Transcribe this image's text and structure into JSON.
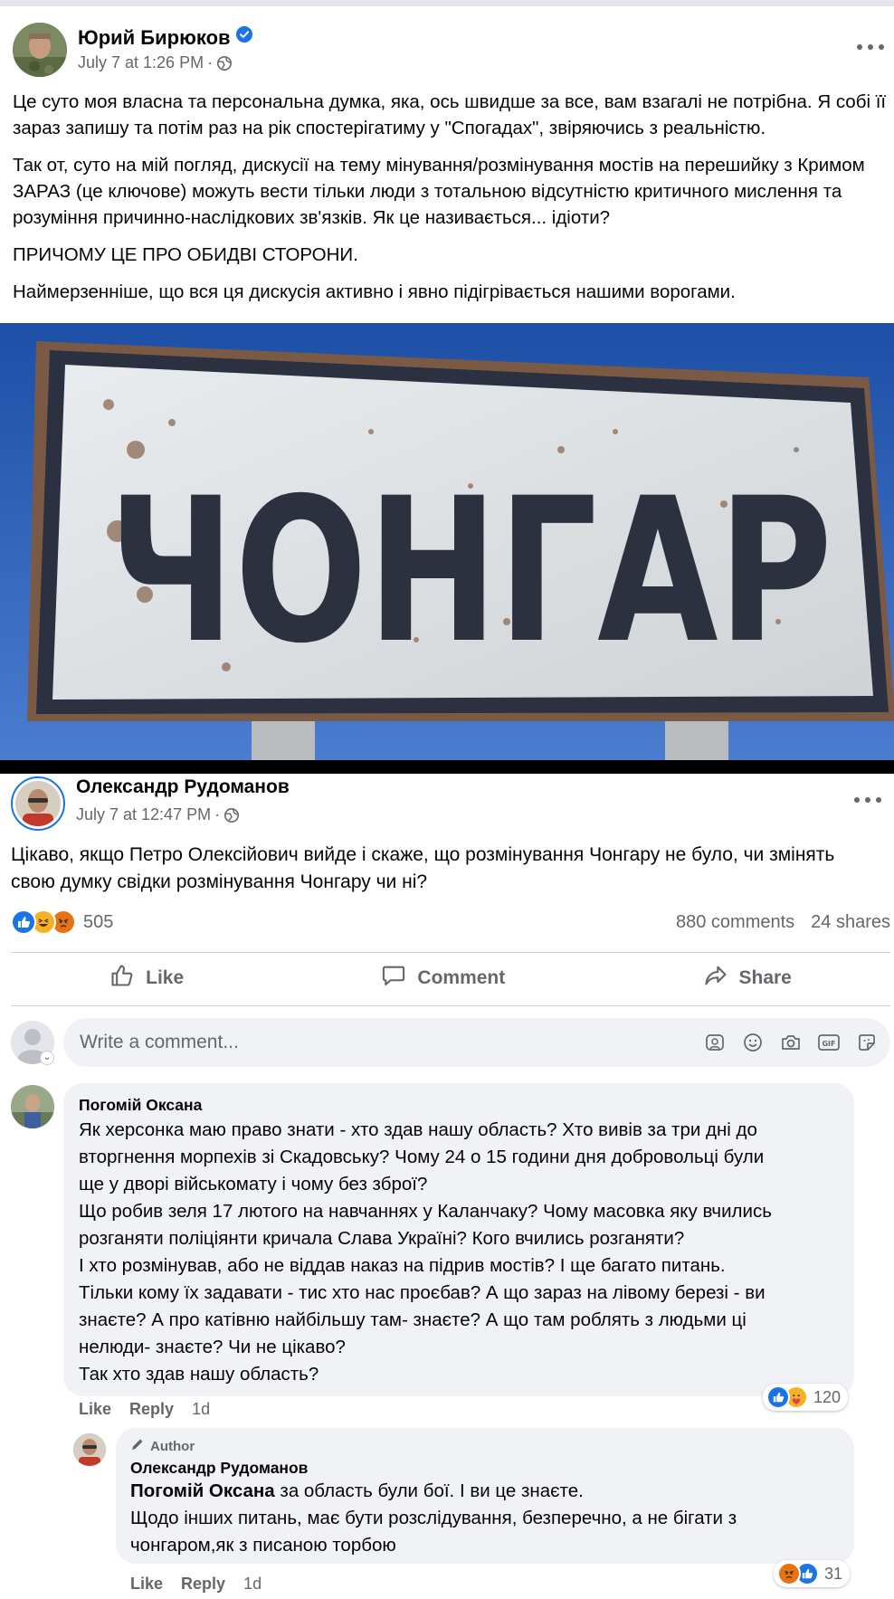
{
  "shared_post": {
    "author": "Юрий Бирюков",
    "timestamp": "July 7 at 1:26 PM",
    "privacy_icon": "globe-icon",
    "verified_icon": "verified-badge-icon",
    "paragraphs": [
      "Це суто моя власна та персональна думка, яка, ось швидше за все, вам взагалі не потрібна. Я собі її зараз запишу та потім раз на рік спостерігатиму у \"Спогадах\", звіряючись з реальністю.",
      "Так от, суто на мій погляд, дискусії на тему мінування/розмінування мостів на перешийку з Кримом ЗАРАЗ (це ключове) можуть вести тільки люди з тотальною відсутністю критичного мислення та розуміння причинно-наслідкових зв'язків. Як це називається... ідіоти?",
      "ПРИЧОМУ ЦЕ ПРО ОБИДВІ СТОРОНИ.",
      "Наймерзенніше, що вся ця дискусія активно і явно підігрівається нашими ворогами."
    ],
    "image": {
      "sign_text": "ЧОНГАР"
    }
  },
  "post": {
    "author": "Олександр Рудоманов",
    "timestamp": "July 7 at 12:47 PM",
    "text": "Цікаво,  якщо Петро Олексійович вийде і скаже, що розмінування Чонгару не було, чи змінять свою думку свідки розмінування Чонгару чи ні?",
    "reaction_count": "505",
    "comments_count": "880 comments",
    "shares_count": "24 shares"
  },
  "actions": {
    "like": "Like",
    "comment": "Comment",
    "share": "Share"
  },
  "composer": {
    "placeholder": "Write a comment..."
  },
  "comments": [
    {
      "author": "Погомій Оксана",
      "lines": [
        "Як херсонка маю право знати - хто здав нашу область? Хто вивів за три дні до",
        "вторгнення морпехів зі Скадовську? Чому 24 о 15 години дня добровольці були",
        "ще у дворі військомату і чому без зброї?",
        "Що робив зеля 17 лютого на навчаннях у Каланчаку? Чому масовка яку вчились",
        "розганяти поліціянти кричала Слава Україні? Кого вчились розганяти?",
        "І хто розмінував, або не віддав наказ на підрив мостів? І ще багато питань.",
        "Тільки кому їх задавати - тис хто нас проєбав? А що зараз на лівому березі - ви",
        "знаєте? А про катівню найбільшу там- знаєте? А що там роблять з людьми ці",
        "нелюди- знаєте? Чи не цікаво?",
        "Так хто здав нашу область?"
      ],
      "reaction_count": "120",
      "like": "Like",
      "reply": "Reply",
      "age": "1d"
    },
    {
      "badge": "Author",
      "author": "Олександр Рудоманов",
      "mention": "Погомій Оксана",
      "first_line_rest": " за область були бої. І ви це знаєте.",
      "lines": [
        "Щодо інших питань, має бути розслідування, безперечно, а не бігати з",
        "чонгаром,як з писаною торбою"
      ],
      "reaction_count": "31",
      "like": "Like",
      "reply": "Reply",
      "age": "1d"
    }
  ],
  "colors": {
    "brand_blue": "#1b74e4",
    "secondary_text": "#65676b",
    "bubble_bg": "#f0f2f5",
    "divider": "#ced0d4"
  }
}
